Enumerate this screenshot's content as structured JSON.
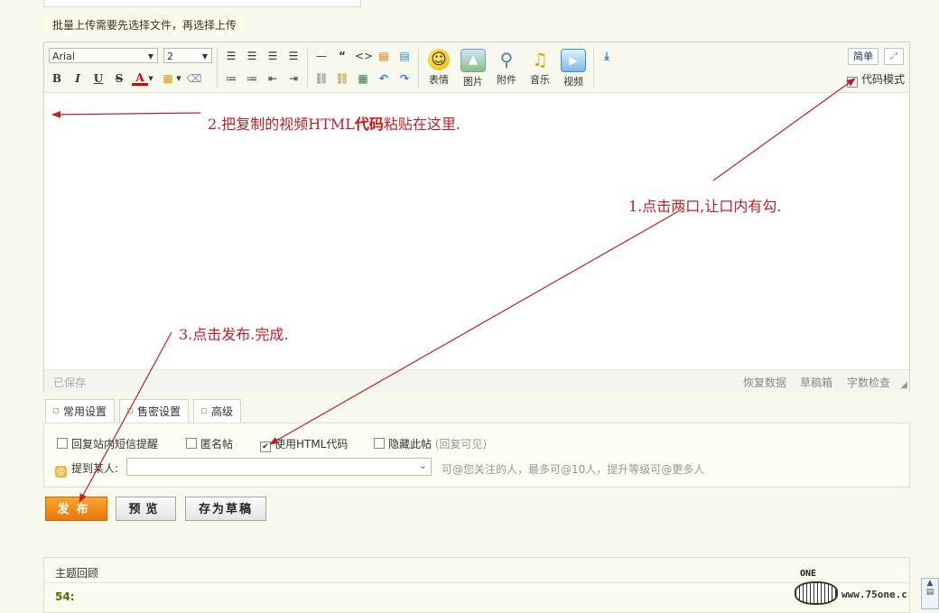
{
  "notice": "批量上传需要先选择文件，再选择上传",
  "toolbar": {
    "font": "Arial",
    "size": "2",
    "emoji": "表情",
    "image": "图片",
    "attachment": "附件",
    "music": "音乐",
    "video": "视频",
    "simple": "简单",
    "code_mode": "代码模式"
  },
  "annotations": {
    "a1": "1.点击两口,让口内有勾.",
    "a2_pre": "2.把复制的视频HTML",
    "a2_bold": "代码",
    "a2_post": "粘贴在这里.",
    "a3": "3.点击发布.完成."
  },
  "status": {
    "saved": "已保存",
    "restore": "恢复数据",
    "drafts": "草稿箱",
    "wordcheck": "字数检查"
  },
  "tabs": [
    "常用设置",
    "售密设置",
    "高级"
  ],
  "options": {
    "sms": "回复站内短信提醒",
    "anonymous": "匿名帖",
    "html": "使用HTML代码",
    "hide": "隐藏此帖",
    "hide_note": "(回复可见)"
  },
  "mention": {
    "label": "提到某人:",
    "hint": "可@您关注的人，最多可@10人，提升等级可@更多人"
  },
  "buttons": {
    "publish": "发布",
    "preview": "预览",
    "draft": "存为草稿"
  },
  "review": {
    "title": "主题回顾",
    "num": "54:"
  },
  "watermark": {
    "logo": "ONE",
    "url": "www.75one.c"
  }
}
